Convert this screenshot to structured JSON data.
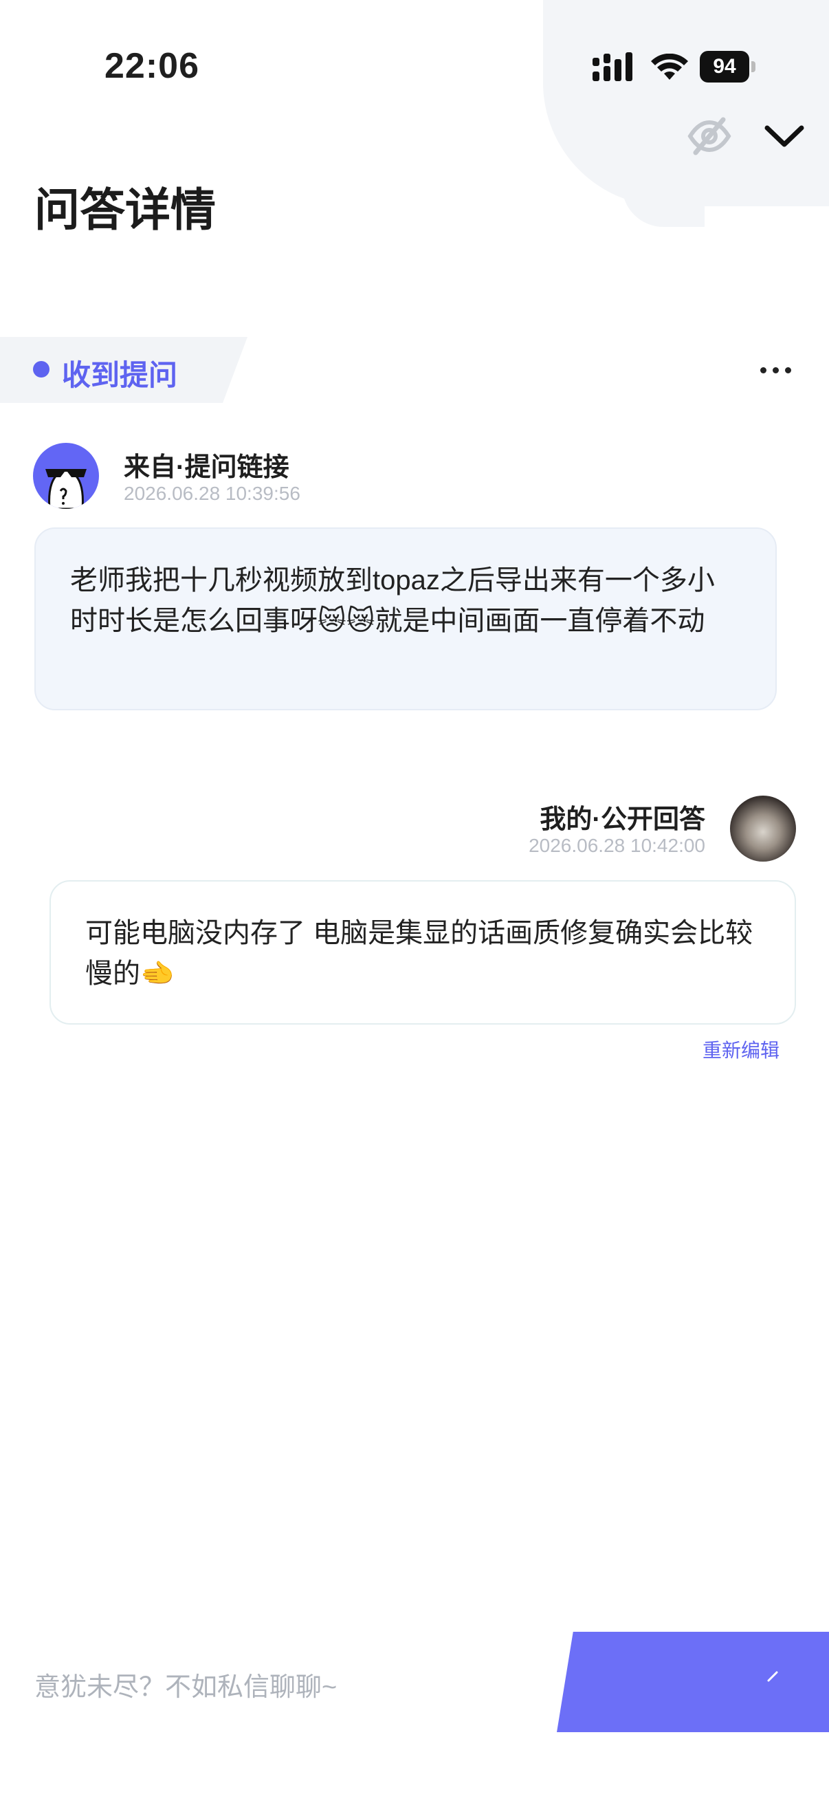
{
  "status_bar": {
    "time": "22:06",
    "battery": "94"
  },
  "header": {
    "title": "问答详情"
  },
  "received_tag": {
    "label": "收到提问"
  },
  "question": {
    "from": "来自·提问链接",
    "time": "2026.06.28 10:39:56",
    "text": "老师我把十几秒视频放到topaz之后导出来有一个多小时时长是怎么回事呀😿😿就是中间画面一直停着不动"
  },
  "answer": {
    "from": "我的·公开回答",
    "time": "2026.06.28 10:42:00",
    "text": "可能电脑没内存了 电脑是集显的话画质修复确实会比较慢的🫲",
    "reedit_label": "重新编辑"
  },
  "footer": {
    "placeholder": "意犹未尽？不如私信聊聊~"
  },
  "colors": {
    "accent": "#5e63f0",
    "button": "#6c6ff7"
  }
}
